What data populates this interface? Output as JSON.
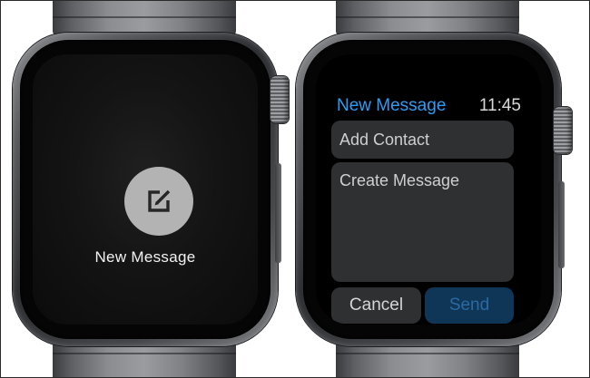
{
  "left_watch": {
    "compose_icon": "compose-icon",
    "compose_label": "New Message"
  },
  "right_watch": {
    "title": "New Message",
    "time": "11:45",
    "contact_field_placeholder": "Add Contact",
    "message_field_placeholder": "Create Message",
    "cancel_label": "Cancel",
    "send_label": "Send"
  },
  "colors": {
    "accent_blue": "#2f9cf4",
    "send_button_bg": "#0f3557",
    "field_bg": "#2f3032",
    "compose_circle": "#b3b3b3"
  }
}
